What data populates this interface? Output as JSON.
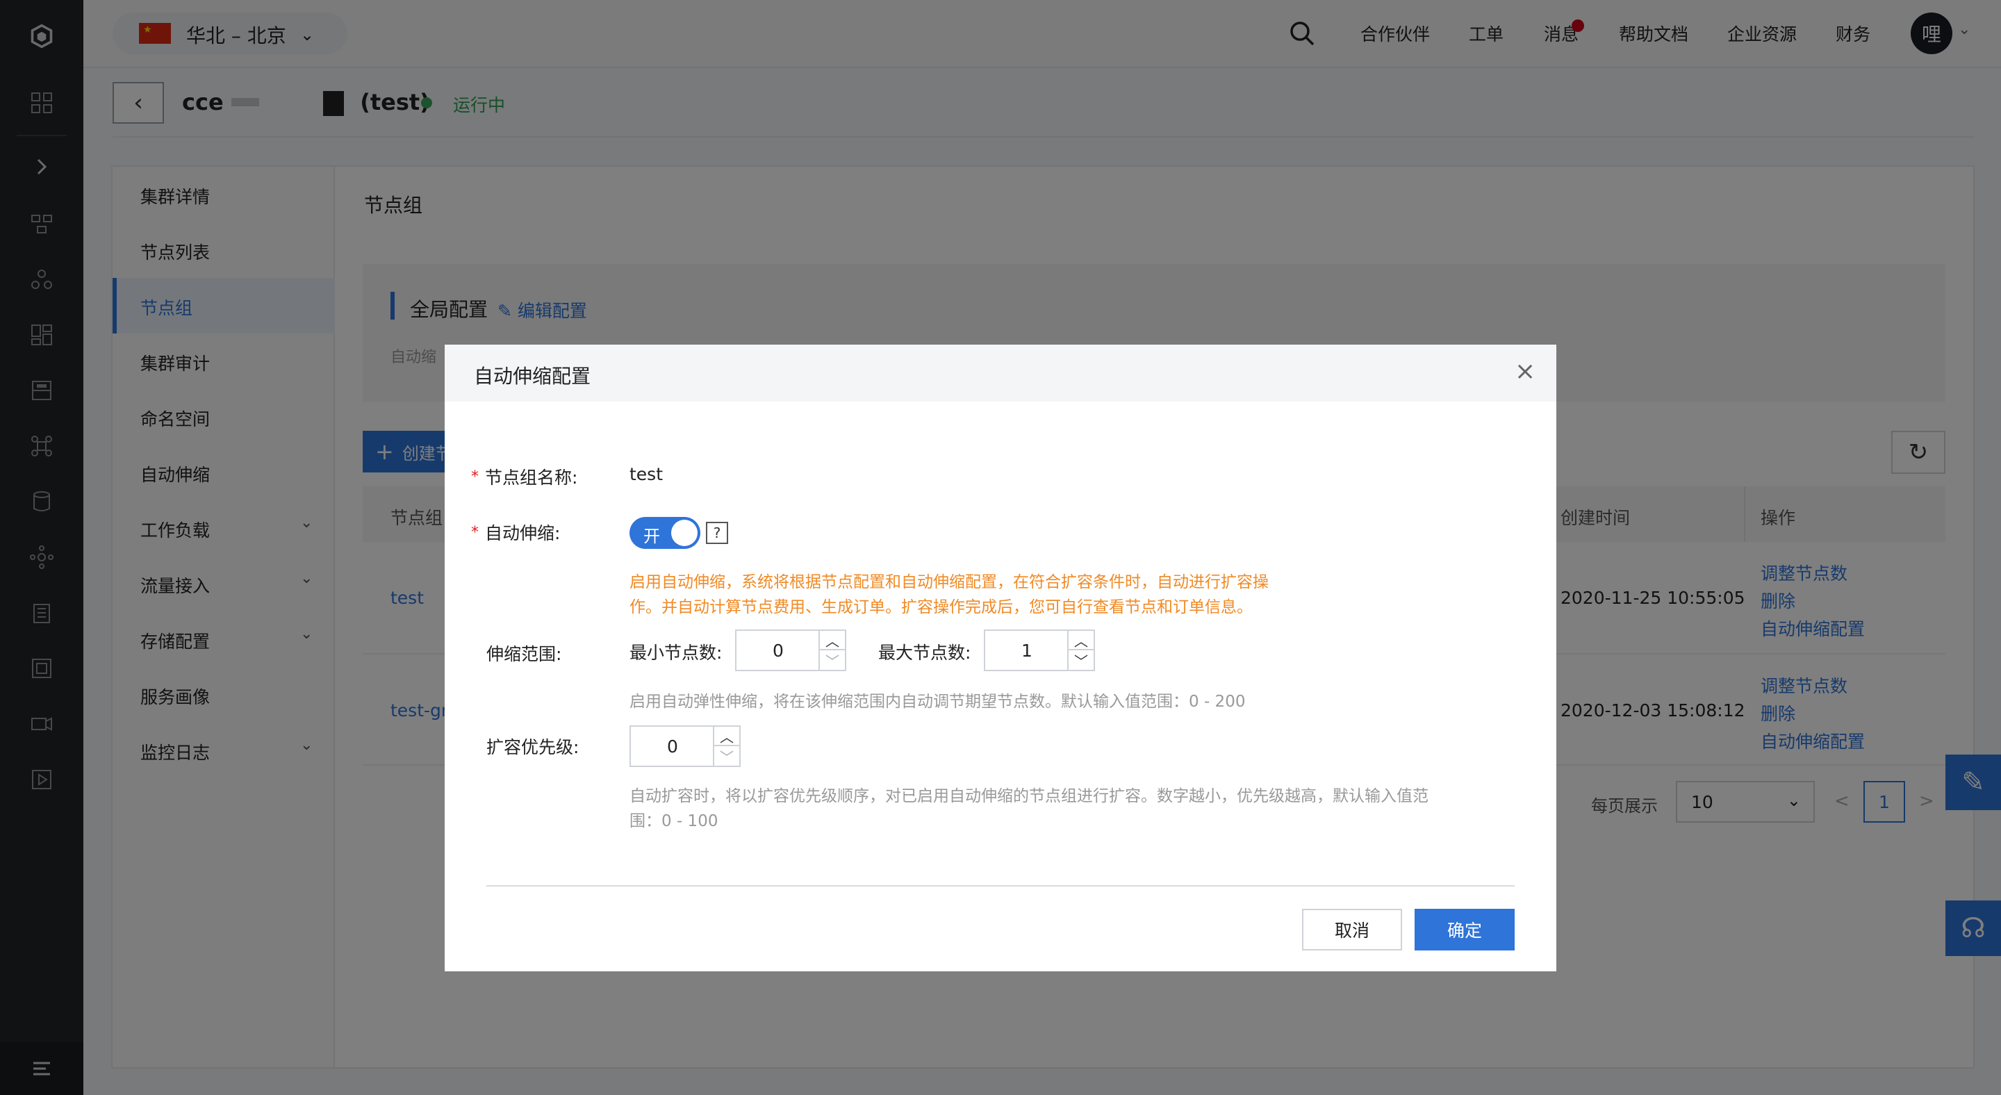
{
  "header": {
    "region": "华北 – 北京",
    "nav": [
      "合作伙伴",
      "工单",
      "消息",
      "帮助文档",
      "企业资源",
      "财务"
    ],
    "avatar": "哩"
  },
  "cluster": {
    "name": "cce",
    "suffix": "(test)",
    "status": "运行中"
  },
  "subnav": {
    "items": [
      "集群详情",
      "节点列表",
      "节点组",
      "集群审计",
      "命名空间",
      "自动伸缩",
      "工作负载",
      "流量接入",
      "存储配置",
      "服务画像",
      "监控日志"
    ],
    "active": "节点组"
  },
  "page": {
    "title": "节点组",
    "global_config_title": "全局配置",
    "edit_config": "编辑配置",
    "auto_hint": "自动缩",
    "create_button": "创建节",
    "table": {
      "headers": [
        "节点组",
        "创建时间",
        "操作"
      ],
      "rows": [
        {
          "name": "test",
          "created": "2020-11-25 10:55:05",
          "actions": [
            "调整节点数",
            "删除",
            "自动伸缩配置"
          ]
        },
        {
          "name": "test-gr",
          "created": "2020-12-03 15:08:12",
          "actions": [
            "调整节点数",
            "删除",
            "自动伸缩配置"
          ]
        }
      ]
    },
    "pagination": {
      "label": "每页展示",
      "page_size": "10",
      "prev": "<",
      "next": ">",
      "current": "1"
    }
  },
  "modal": {
    "title": "自动伸缩配置",
    "close": "×",
    "name_label": "节点组名称:",
    "name_value": "test",
    "autoscale_label": "自动伸缩:",
    "toggle_text": "开",
    "help_mark": "?",
    "warn_line1": "启用自动伸缩，系统将根据节点配置和自动伸缩配置，在符合扩容条件时，自动进行扩容操",
    "warn_line2": "作。并自动计算节点费用、生成订单。扩容操作完成后，您可自行查看节点和订单信息。",
    "range_label": "伸缩范围:",
    "min_label": "最小节点数:",
    "min_value": "0",
    "max_label": "最大节点数:",
    "max_value": "1",
    "range_hint": "启用自动弹性伸缩，将在该伸缩范围内自动调节期望节点数。默认输入值范围：0 - 200",
    "priority_label": "扩容优先级:",
    "priority_value": "0",
    "priority_hint1": "自动扩容时，将以扩容优先级顺序，对已启用自动伸缩的节点组进行扩容。数字越小，优先级越高，默认输入值范",
    "priority_hint2": "围：0 - 100",
    "cancel": "取消",
    "ok": "确定"
  },
  "colors": {
    "primary": "#2f74d8",
    "warning": "#f08a24",
    "sidebar": "#232427",
    "status_ok": "#3ba55c"
  }
}
